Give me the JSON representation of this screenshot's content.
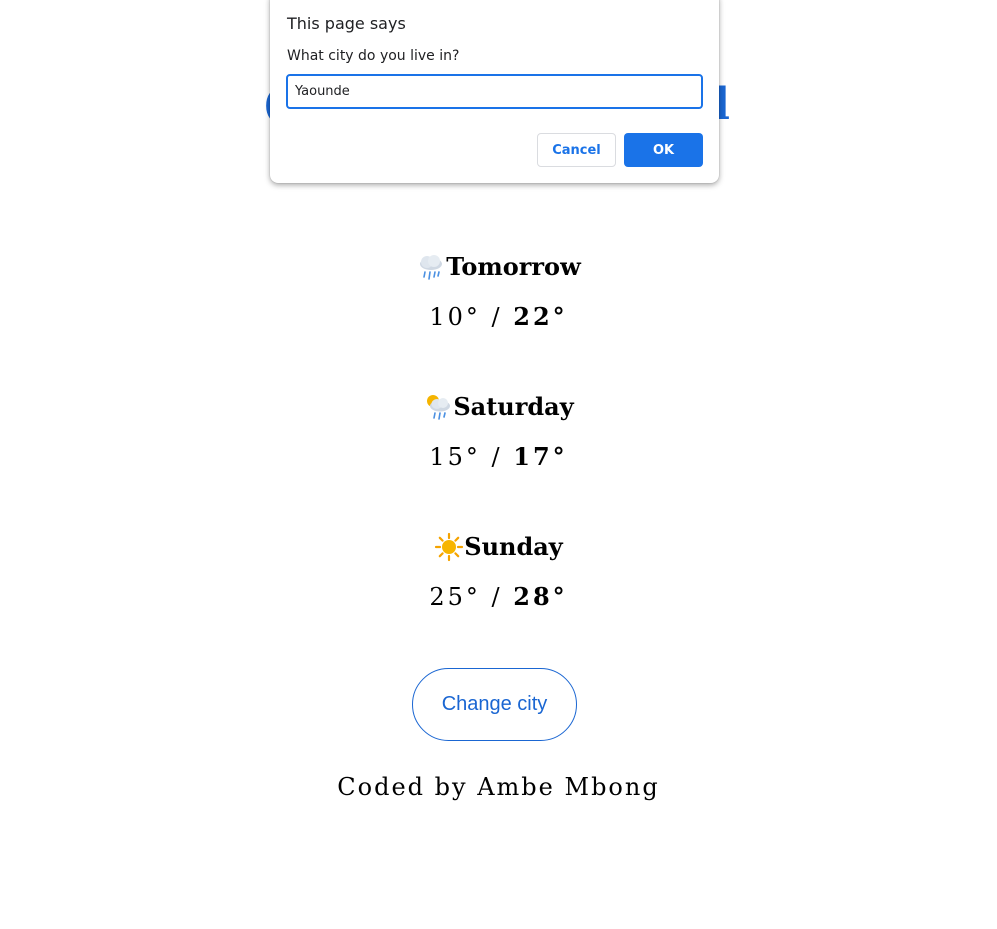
{
  "page": {
    "colors": {
      "accent": "#1a66d2",
      "text": "#000000",
      "background": "#ffffff"
    }
  },
  "forecast": [
    {
      "day": "Tomorrow",
      "icon": "rain-cloud-icon",
      "min": "10°",
      "separator": "/",
      "max": "22°"
    },
    {
      "day": "Saturday",
      "icon": "sun-behind-rain-cloud-icon",
      "min": "15°",
      "separator": "/",
      "max": "17°"
    },
    {
      "day": "Sunday",
      "icon": "sun-icon",
      "min": "25°",
      "separator": "/",
      "max": "28°"
    }
  ],
  "change_city_button": {
    "label": "Change city"
  },
  "credit": "Coded by Ambe Mbong",
  "dialog": {
    "title": "This page says",
    "message": "What city do you live in?",
    "input_value": "Yaounde",
    "cancel_label": "Cancel",
    "ok_label": "OK",
    "colors": {
      "primary": "#1a73e8",
      "border": "#dadce0"
    }
  }
}
